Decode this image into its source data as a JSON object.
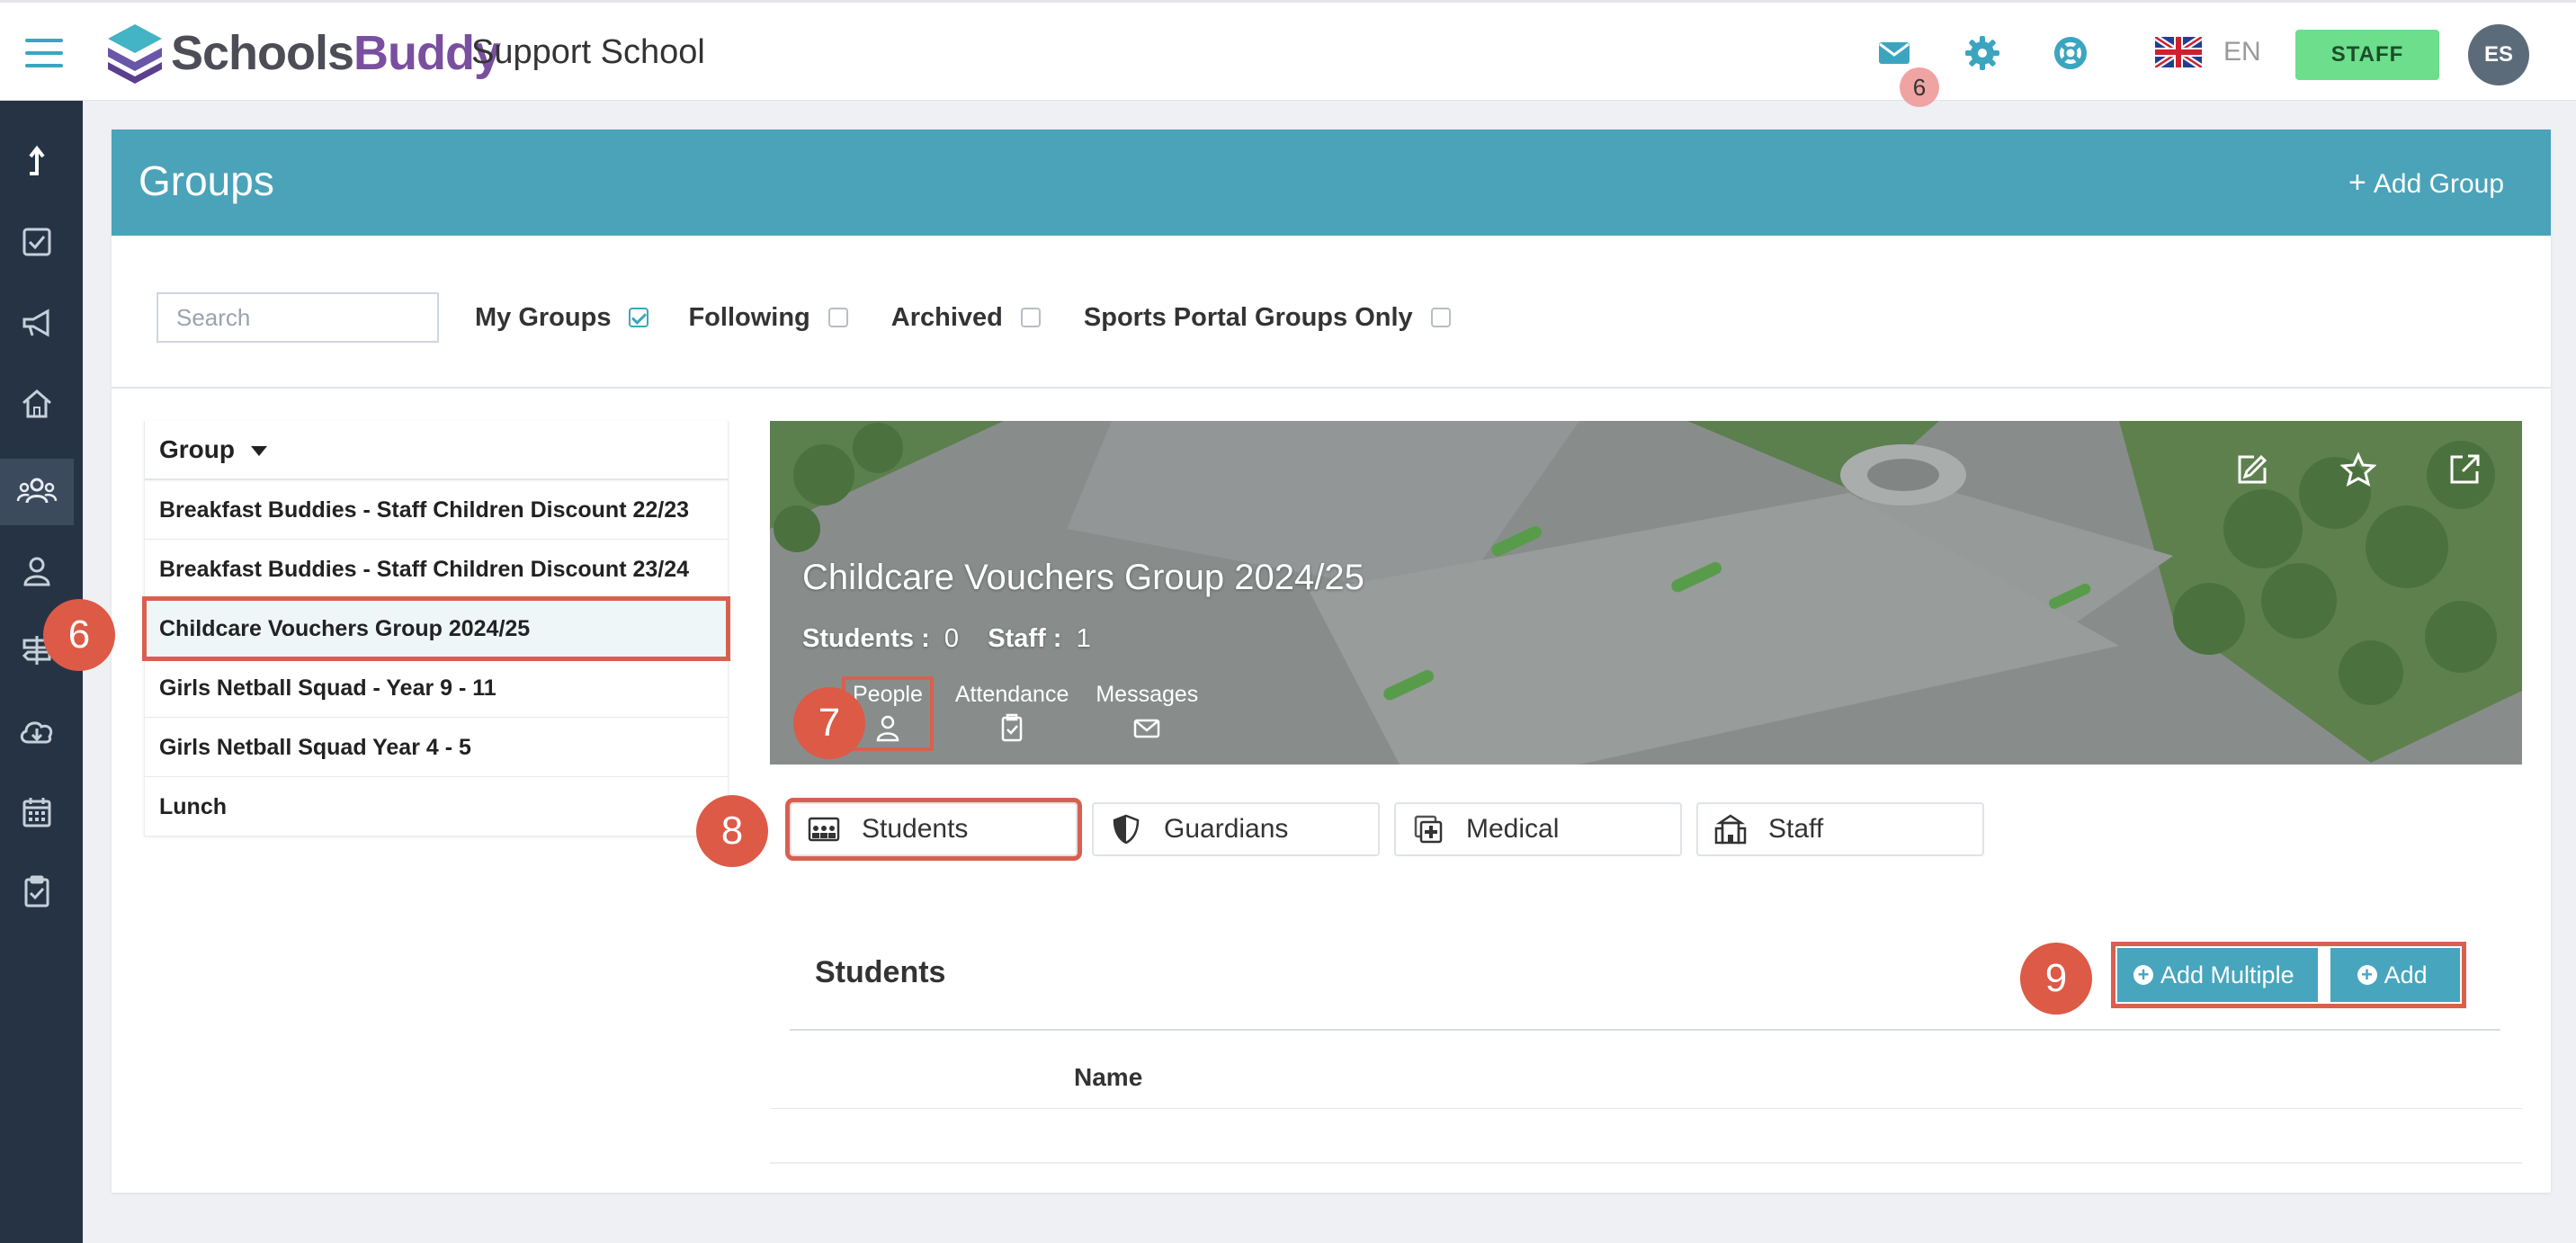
{
  "app": {
    "logo_part1": "Schools",
    "logo_part2": "Buddy",
    "school_name": "Support School",
    "mail_badge": "6",
    "language": "EN",
    "role_button": "STAFF",
    "avatar_initials": "ES"
  },
  "page": {
    "title": "Groups",
    "add_group_label": "Add Group"
  },
  "filters": {
    "search_placeholder": "Search",
    "my_groups": "My Groups",
    "my_groups_checked": true,
    "following": "Following",
    "archived": "Archived",
    "sports_only": "Sports Portal Groups Only"
  },
  "group_list": {
    "header": "Group",
    "items": [
      "Breakfast Buddies - Staff Children Discount 22/23",
      "Breakfast Buddies - Staff Children Discount 23/24",
      "Childcare Vouchers Group 2024/25",
      "Girls Netball Squad - Year 9 - 11",
      "Girls Netball Squad Year 4 - 5",
      "Lunch"
    ],
    "selected_index": 2
  },
  "group_detail": {
    "title": "Childcare Vouchers Group 2024/25",
    "students_label": "Students :",
    "students_count": "0",
    "staff_label": "Staff :",
    "staff_count": "1",
    "tabs": [
      "People",
      "Attendance",
      "Messages"
    ],
    "active_tab": "People"
  },
  "people_tabs": [
    "Students",
    "Guardians",
    "Medical",
    "Staff"
  ],
  "students_section": {
    "title": "Students",
    "add_multiple_label": "Add Multiple",
    "add_label": "Add",
    "column_name": "Name"
  },
  "steps": [
    "6",
    "7",
    "8",
    "9"
  ],
  "colors": {
    "accent": "#4aa3b8",
    "sidebar": "#263344",
    "highlight": "#d9604f",
    "staff_button": "#6cde8c"
  }
}
